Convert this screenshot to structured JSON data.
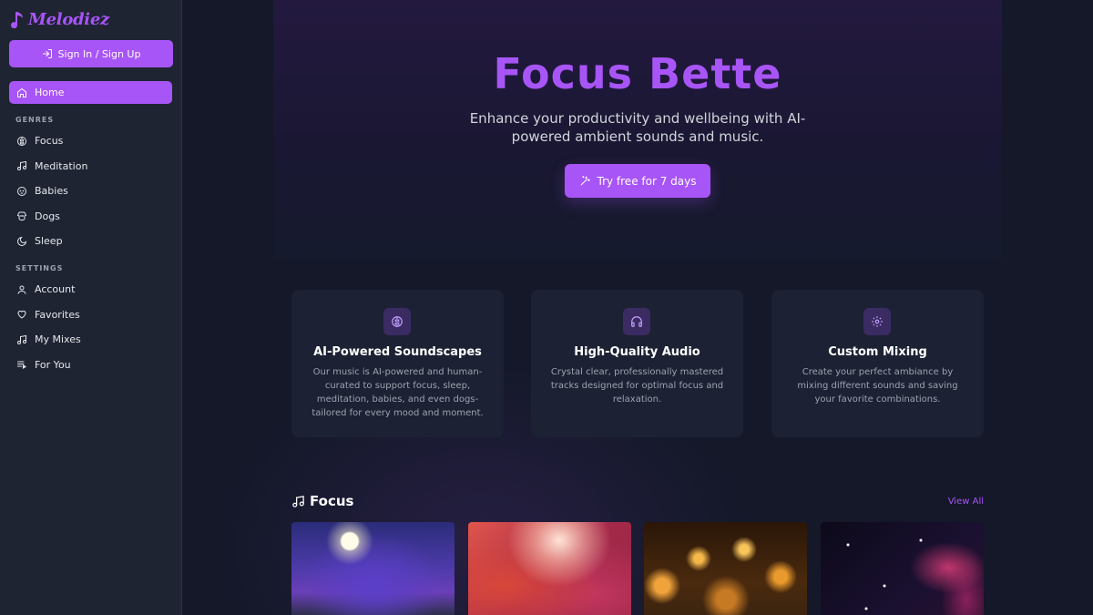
{
  "brand": {
    "name": "Melodiez",
    "accent": "#a855f7"
  },
  "sidebar": {
    "signin_label": "Sign In / Sign Up",
    "home_label": "Home",
    "genres_heading": "GENRES",
    "genres": [
      {
        "label": "Focus",
        "icon": "brain-icon"
      },
      {
        "label": "Meditation",
        "icon": "music-note-icon"
      },
      {
        "label": "Babies",
        "icon": "baby-face-icon"
      },
      {
        "label": "Dogs",
        "icon": "dog-icon"
      },
      {
        "label": "Sleep",
        "icon": "moon-icon"
      }
    ],
    "settings_heading": "SETTINGS",
    "settings": [
      {
        "label": "Account",
        "icon": "user-icon"
      },
      {
        "label": "Favorites",
        "icon": "heart-icon"
      },
      {
        "label": "My Mixes",
        "icon": "music-note-icon"
      },
      {
        "label": "For You",
        "icon": "playlist-icon"
      }
    ]
  },
  "hero": {
    "title": "Focus Bette",
    "subtitle": "Enhance your productivity and wellbeing with AI-powered ambient sounds and music.",
    "cta_label": "Try free for 7 days"
  },
  "features": [
    {
      "title": "AI-Powered Soundscapes",
      "desc": "Our music is AI-powered and human-curated to support focus, sleep, meditation, babies, and even dogs-tailored for every mood and moment.",
      "icon": "brain-icon"
    },
    {
      "title": "High-Quality Audio",
      "desc": "Crystal clear, professionally mastered tracks designed for optimal focus and relaxation.",
      "icon": "headphones-icon"
    },
    {
      "title": "Custom Mixing",
      "desc": "Create your perfect ambiance by mixing different sounds and saving your favorite combinations.",
      "icon": "gear-icon"
    }
  ],
  "focus_section": {
    "title": "Focus",
    "view_all_label": "View All",
    "thumbnails": [
      "moonlit-garden",
      "red-canyon",
      "warm-cafe-lights",
      "starry-nebula"
    ]
  }
}
